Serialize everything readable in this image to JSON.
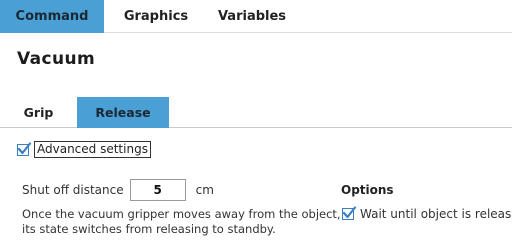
{
  "top_tabs": {
    "command": "Command",
    "graphics": "Graphics",
    "variables": "Variables",
    "active": "Command"
  },
  "page_title": "Vacuum",
  "inner_tabs": {
    "grip": "Grip",
    "release": "Release",
    "active": "Release"
  },
  "advanced_settings": {
    "label": "Advanced settings",
    "checked": true
  },
  "shut_off": {
    "label": "Shut off distance",
    "value": "5",
    "unit": "cm",
    "description": "Once the vacuum gripper moves away from the object, its state switches from releasing to standby."
  },
  "options": {
    "title": "Options",
    "wait_label": "Wait until object is released",
    "wait_checked": true
  },
  "colors": {
    "accent": "#4a9fd5",
    "checkbox_border": "#3a7fbf"
  }
}
